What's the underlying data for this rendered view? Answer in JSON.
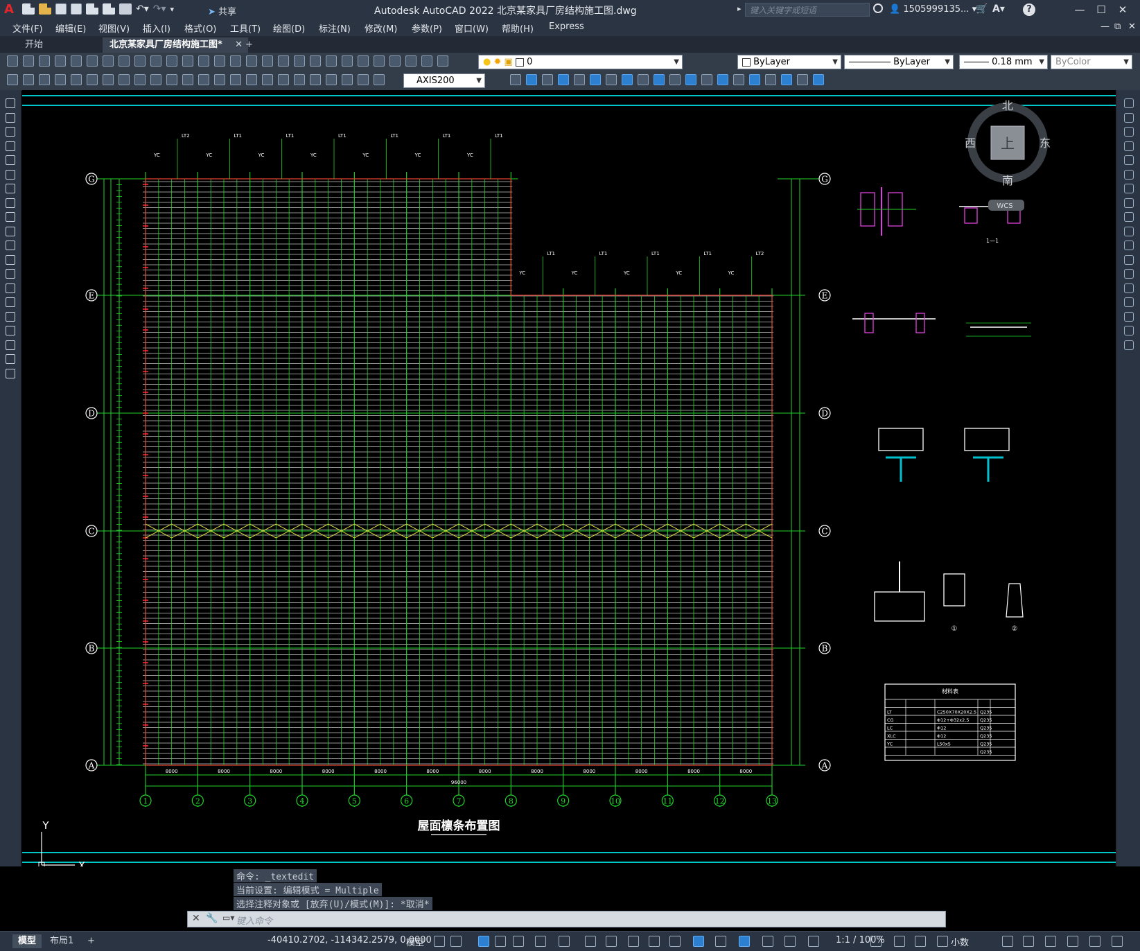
{
  "app": {
    "logo_letter": "A",
    "title": "Autodesk AutoCAD 2022    北京某家具厂房结构施工图.dwg",
    "share_label": "共享",
    "search_placeholder": "键入关键字或短语",
    "user": "1505999135...",
    "help": "?"
  },
  "menu": [
    "文件(F)",
    "编辑(E)",
    "视图(V)",
    "插入(I)",
    "格式(O)",
    "工具(T)",
    "绘图(D)",
    "标注(N)",
    "修改(M)",
    "参数(P)",
    "窗口(W)",
    "帮助(H)",
    "Express"
  ],
  "tabs": {
    "start": "开始",
    "active": "北京某家具厂房结构施工图*",
    "close": "✕",
    "add": "+"
  },
  "toolbar": {
    "layer": "0",
    "color": "ByLayer",
    "linetype": "ByLayer",
    "lineweight": "0.18 mm",
    "plotstyle": "ByColor",
    "dimstyle": "AXIS200"
  },
  "viewcube": {
    "north": "北",
    "south": "南",
    "east": "东",
    "west": "西",
    "top": "上",
    "wcs": "WCS"
  },
  "drawing": {
    "plan_title": "屋面檩条布置图",
    "row_axes": [
      "G",
      "E",
      "D",
      "C",
      "B",
      "A"
    ],
    "col_axes": [
      "1",
      "2",
      "3",
      "4",
      "5",
      "6",
      "7",
      "8",
      "9",
      "10",
      "11",
      "12",
      "13"
    ],
    "bay_dim": "8000",
    "total_dim": "96000",
    "purlin_tag": "LT1",
    "purlin_tag2": "LT2",
    "brace_tag": "YC",
    "detail_labels": {
      "section": "1—1",
      "circle1": "①",
      "circle2": "②"
    },
    "ucs": {
      "x": "X",
      "y": "Y"
    }
  },
  "material_table": {
    "title": "材料表",
    "rows": [
      [
        "LT",
        "",
        "C250X70X20X2.5",
        "Q235",
        ""
      ],
      [
        "CG",
        "",
        "Φ12+Φ32x2.5",
        "Q235",
        ""
      ],
      [
        "LC",
        "",
        "Φ12",
        "Q235",
        ""
      ],
      [
        "XLC",
        "",
        "Φ12",
        "Q235",
        ""
      ],
      [
        "YC",
        "",
        "L50x5",
        "Q235",
        ""
      ],
      [
        "",
        "",
        "",
        "Q235",
        ""
      ]
    ]
  },
  "command": {
    "history": [
      "命令: _textedit",
      "当前设置: 编辑模式 = Multiple",
      "选择注释对象或 [放弃(U)/模式(M)]: *取消*"
    ],
    "placeholder": "键入命令"
  },
  "status": {
    "model_tab": "模型",
    "layout_tab": "布局1",
    "add_tab": "+",
    "coords": "-40410.2702, -114342.2579, 0.0000",
    "space": "模型",
    "scale": "1:1 / 100%",
    "units": "小数"
  },
  "colors": {
    "grid_green": "#22d52a",
    "purlin_white": "#e8e8e8",
    "axis_circle": "#ffffff",
    "brace_yellow": "#d6d63a",
    "border_cyan": "#00c8c8",
    "accent_blue": "#2d7fd0"
  }
}
